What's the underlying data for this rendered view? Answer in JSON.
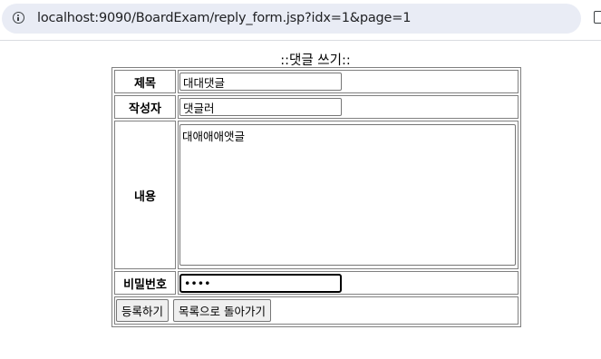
{
  "browser": {
    "url": "localhost:9090/BoardExam/reply_form.jsp?idx=1&page=1"
  },
  "page": {
    "heading": "::댓글 쓰기::"
  },
  "form": {
    "subject_label": "제목",
    "subject_value": "대대댓글",
    "writer_label": "작성자",
    "writer_value": "댓글러",
    "content_label": "내용",
    "content_value": "대애애애앳글",
    "password_label": "비밀번호",
    "password_value": "1234",
    "submit_label": "등록하기",
    "back_label": "목록으로 돌아가기"
  }
}
